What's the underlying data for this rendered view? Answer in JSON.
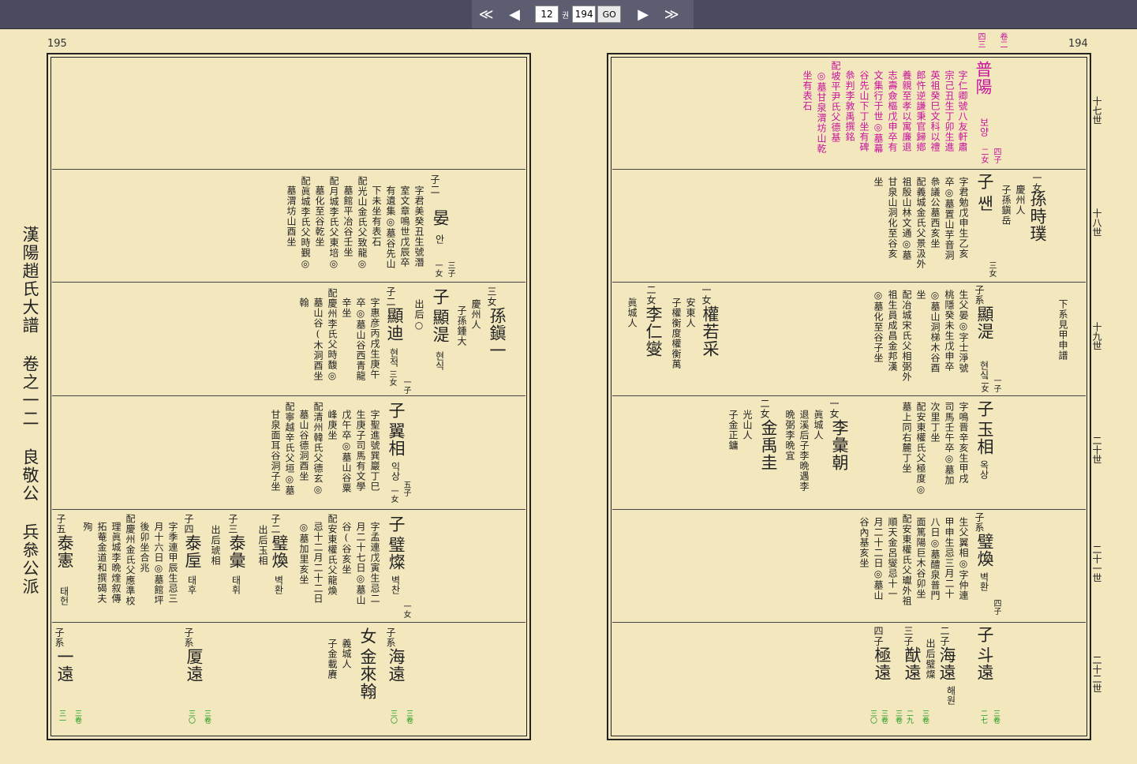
{
  "toolbar": {
    "first": "≪",
    "prev": "◀",
    "page": "12",
    "unit": "권",
    "total": "194",
    "go": "GO",
    "next": "▶",
    "last": "≫"
  },
  "pages": {
    "left": "195",
    "right": "194"
  },
  "book_title": "漢陽趙氏大譜 卷之一二 良敬公 兵叅公派",
  "generations": [
    "十七世",
    "十八世",
    "十九世",
    "二十世",
    "二十一世",
    "二十二世"
  ],
  "right": {
    "r1": {
      "ref_a": "卷二",
      "ref_b": "四三",
      "name": "普陽",
      "hangul": "보양",
      "kids": "四子",
      "kids2": "二女",
      "c1": "字仁卿號八友軒肅",
      "c2": "宗己丑生丁卯生進",
      "c3": "英祖癸巳文科以禮",
      "c4": "郎忤逆謙秉官歸鄕",
      "c5": "養親至孝以寓廉退",
      "c6": "志壽僉樞戊申卒有",
      "c7": "文集行于世◎墓幕",
      "c8": "谷先山下丁坐有碑",
      "c9": "叅判李敦禹撰銘",
      "c10": "配坡平尹氏父德基",
      "c11": "◎墓甘泉渭坊山乾",
      "c12": "坐有表石"
    },
    "r2": {
      "label": "子",
      "name": "쌘",
      "kids": "三女",
      "d1": "一女",
      "d2": "孫時璞",
      "d3": "慶州人",
      "d4": "子孫鎭岳",
      "c1": "字君勉戊申生乙亥",
      "c2": "卒◎墓置山芋音洞",
      "c3": "叅議公墓西亥坐",
      "c4": "配義城金氏父景汲外",
      "c5": "祖殷山林文通◎墓",
      "c6": "甘泉山洞化至谷亥",
      "c7": "坐"
    },
    "r3": {
      "label": "子系",
      "name": "顯湜",
      "hangul": "현식",
      "kids": "一子",
      "kids2": "二女",
      "c1": "生父晏◎字士淨號",
      "c2": "桃隱癸未生戊申卒",
      "c3": "◎墓山洞梯木谷酉",
      "c4": "坐",
      "c5": "配冶城宋氏父相弼外",
      "c6": "祖生員成昌金邦漢",
      "c7": "◎墓化至谷子坐",
      "d1": "一女",
      "d2": "權若采",
      "d3": "安東人",
      "d4": "子權衡度權衡萬",
      "e1": "二女",
      "e2": "李仁燮",
      "e3": "眞城人",
      "f1": "下系見甲申譜"
    },
    "r4": {
      "label": "子",
      "name": "玉相",
      "hangul": "옥상",
      "c1": "字鳴晋辛亥生甲戌",
      "c2": "司馬壬午卒◎墓加",
      "c3": "次里丁坐",
      "c4": "配安東權氏父極度◎",
      "c5": "墓上同右麓丁坐",
      "d1": "一女",
      "d2": "李彙朝",
      "d3": "眞城人",
      "d4": "退溪后子李晩遇李",
      "d5": "晩弼李晩宜",
      "e1": "二女",
      "e2": "金禹圭",
      "e3": "光山人",
      "e4": "子金正鏞"
    },
    "r5": {
      "label": "子系",
      "name": "璧煥",
      "hangul": "벽환",
      "kids": "四子",
      "c1": "生父翼相◎字仲連",
      "c2": "甲申生忌三月二十",
      "c3": "八日◎墓醴泉普門",
      "c4": "面篤陽巨木谷卯坐",
      "c5": "配安東權氏父瓛外祖",
      "c6": "順天金呂燮忌十一",
      "c7": "月二十二日◎墓山",
      "c8": "谷內基亥坐"
    },
    "r6": {
      "label": "子",
      "name": "斗遠",
      "note": "二子",
      "name2": "海遠",
      "hangul2": "해원",
      "note2": "出后璧燦",
      "l3": "三子",
      "name3": "猷遠",
      "l4": "四子",
      "name4": "極遠",
      "g1": "三卷",
      "g2": "二七",
      "g3": "三卷",
      "g4": "二九",
      "g5": "三卷",
      "g6": "三卷",
      "g7": "三〇"
    }
  },
  "left": {
    "r2": {
      "label": "子二",
      "name": "晏",
      "hangul": "안",
      "kids": "三子",
      "kids2": "一女",
      "c1": "字君美癸丑生號潛",
      "c2": "室文章鳴世戊辰卒",
      "c3": "有遺集◎墓谷先山",
      "c4": "下未坐有表石",
      "c5": "配光山金氏父致龍◎",
      "c6": "墓館平冶谷壬坐",
      "c7": "配月城李氏父東培◎",
      "c8": "墓化至谷乾坐",
      "c9": "配眞城李氏父時覲◎",
      "c10": "墓渭坊山酉坐"
    },
    "r3": {
      "label": "子",
      "name": "顯湜",
      "hangul": "현식",
      "note": "出后○",
      "d1": "三女",
      "d2": "孫鎭一",
      "d3": "慶州人",
      "d4": "子孫鍾大",
      "e1": "子二",
      "e2": "顯迪",
      "e3": "현적",
      "e4": "一子",
      "e5": "三女",
      "c1": "字惠彦丙戌生庚午",
      "c2": "卒◎墓山谷西青龍",
      "c3": "辛坐",
      "c4": "配慶州李氏父時馥◎",
      "c5": "墓山谷(木洞酉坐",
      "c6": "翰"
    },
    "r4": {
      "label": "子",
      "name": "翼相",
      "hangul": "익상",
      "kids": "五子",
      "kids2": "一女",
      "c1": "字聖進號巽巖丁巳",
      "c2": "生庚子司馬有文學",
      "c3": "戊午卒◎墓山谷粟",
      "c4": "峰庚坐",
      "c5": "配清州韓氏父德玄◎",
      "c6": "墓山谷德洞酉坐",
      "c7": "配寧越辛氏父垣◎墓",
      "c8": "甘泉面耳谷洞子坐"
    },
    "r5": {
      "label": "子",
      "name": "璧燦",
      "hangul": "벽찬",
      "kids": "一女",
      "c1": "字孟連戊寅生忌二",
      "c2": "月二十七日◎墓山",
      "c3": "谷(谷亥坐",
      "c4": "配安東權氏父龍煥",
      "c5": "忌十二月二十二日",
      "c6": "◎墓加里亥坐",
      "s2": "子二",
      "s2n": "璧煥",
      "s2h": "벽환",
      "s2note": "出后玉相",
      "s3": "子三",
      "s3n": "泰彙",
      "s3h": "태휘",
      "s4": "子四",
      "s4n": "泰垕",
      "s4h": "태후",
      "s4note": "出后琥相",
      "s4c1": "字季連甲辰生忌三",
      "s4c2": "月十六日◎墓館坪",
      "s4c3": "後卯坐合兆",
      "s4c4": "配慶州金氏父應準校",
      "s4c5": "理眞城李晩煃叙傳",
      "s4c6": "拓菴金道和撰碣夫",
      "s4c7": "殉",
      "s5": "子五",
      "s5n": "泰憲",
      "s5h": "태헌"
    },
    "r6": {
      "l1": "子系",
      "n1": "海遠",
      "g1a": "三卷",
      "g1b": "三〇",
      "l2": "女",
      "n2": "金來翰",
      "d1": "義城人",
      "d2": "子金載賡",
      "l3": "子系",
      "n3": "厦遠",
      "g3a": "三卷",
      "g3b": "三〇",
      "l4": "子系",
      "n4": "一遠",
      "g4a": "三卷",
      "g4b": "三一"
    }
  }
}
